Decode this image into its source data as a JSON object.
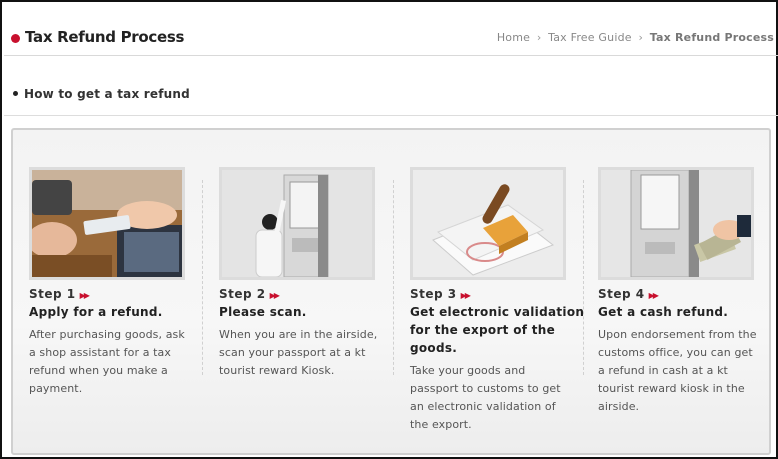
{
  "header": {
    "title": "Tax Refund Process",
    "breadcrumb": [
      "Home",
      "Tax Free Guide",
      "Tax Refund Process"
    ]
  },
  "section": {
    "title": "How to get a tax refund"
  },
  "steps": [
    {
      "label": "Step 1",
      "title": "Apply for a refund.",
      "description": "After purchasing goods, ask a shop assistant for a tax refund when you make a payment.",
      "image": "card-payment-photo"
    },
    {
      "label": "Step 2",
      "title": "Please scan.",
      "description": "When you are in the airside, scan your passport at a kt tourist reward Kiosk.",
      "image": "kiosk-scan-photo"
    },
    {
      "label": "Step 3",
      "title": "Get electronic validation for the export of the goods.",
      "description": "Take your goods and passport to customs to get an electronic validation of the export.",
      "image": "stamp-document-photo"
    },
    {
      "label": "Step 4",
      "title": "Get a cash refund.",
      "description": "Upon endorsement from the customs office, you can get a refund in cash at a kt tourist reward kiosk in the airside.",
      "image": "kiosk-cash-photo"
    }
  ],
  "colors": {
    "accent": "#c8102e",
    "panel_border": "#d0d0d0"
  }
}
